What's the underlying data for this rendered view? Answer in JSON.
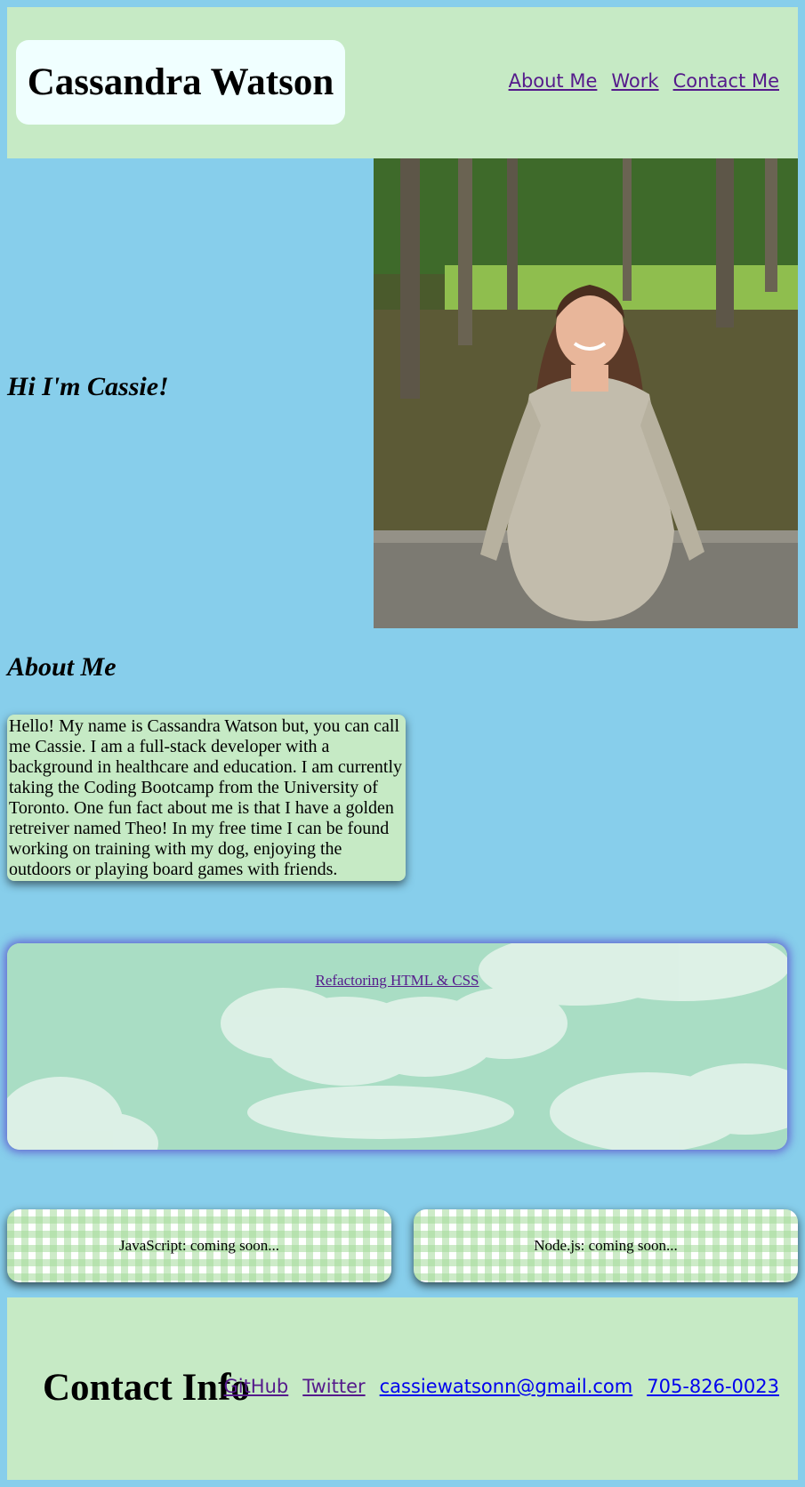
{
  "header": {
    "name": "Cassandra Watson",
    "nav": [
      "About Me",
      "Work",
      "Contact Me"
    ]
  },
  "hero": {
    "title": "Hi I'm Cassie!"
  },
  "about": {
    "title": "About Me",
    "text": "Hello! My name is Cassandra Watson but, you can call me Cassie. I am a full-stack developer with a background in healthcare and education. I am currently taking the Coding Bootcamp from the University of Toronto. One fun fact about me is that I have a golden retreiver named Theo! In my free time I can be found working on training with my dog, enjoying the outdoors or playing board games with friends."
  },
  "work": {
    "featured": "Refactoring HTML & CSS",
    "items": [
      "JavaScript: coming soon...",
      "Node.js: coming soon..."
    ]
  },
  "contact": {
    "title": "Contact Info",
    "github": "GitHub",
    "twitter": "Twitter",
    "email": "cassiewatsonn@gmail.com",
    "phone": "705-826-0023"
  },
  "colors": {
    "page_bg": "#87ceeb",
    "panel": "#c6eac5",
    "name_box": "#f0ffff",
    "visited_link": "#551a8b",
    "link": "#0000ee"
  }
}
